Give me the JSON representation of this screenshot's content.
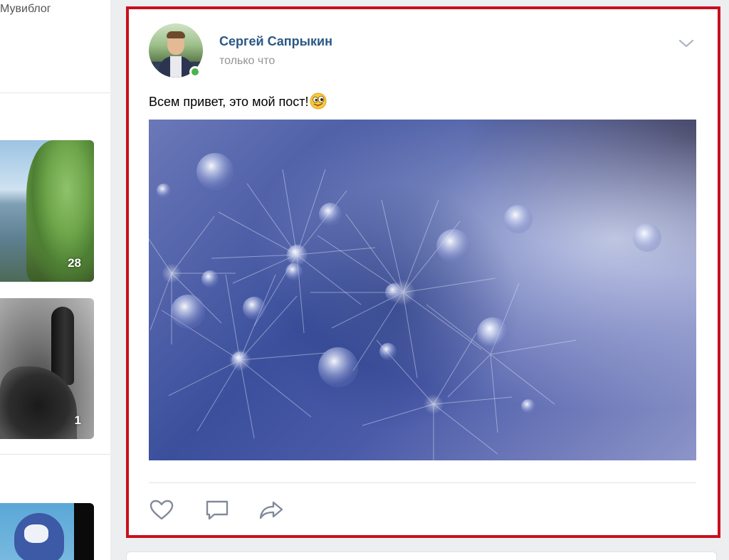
{
  "left_column": {
    "cut_text": "Мувиблог",
    "albums": [
      {
        "count": "28"
      },
      {
        "count": "1"
      },
      {
        "count": ""
      }
    ]
  },
  "post": {
    "author_name": "Сергей Сапрыкин",
    "time": "только что",
    "text": "Всем привет, это мой пост!",
    "online": true,
    "highlight_color": "#c8101e",
    "link_color": "#2a5885",
    "online_color": "#4bb34b"
  },
  "icons": {
    "menu": "chevron-down-icon",
    "like": "heart-icon",
    "comment": "comment-icon",
    "share": "share-arrow-icon",
    "emoji": "winking-tongue-emoji"
  }
}
